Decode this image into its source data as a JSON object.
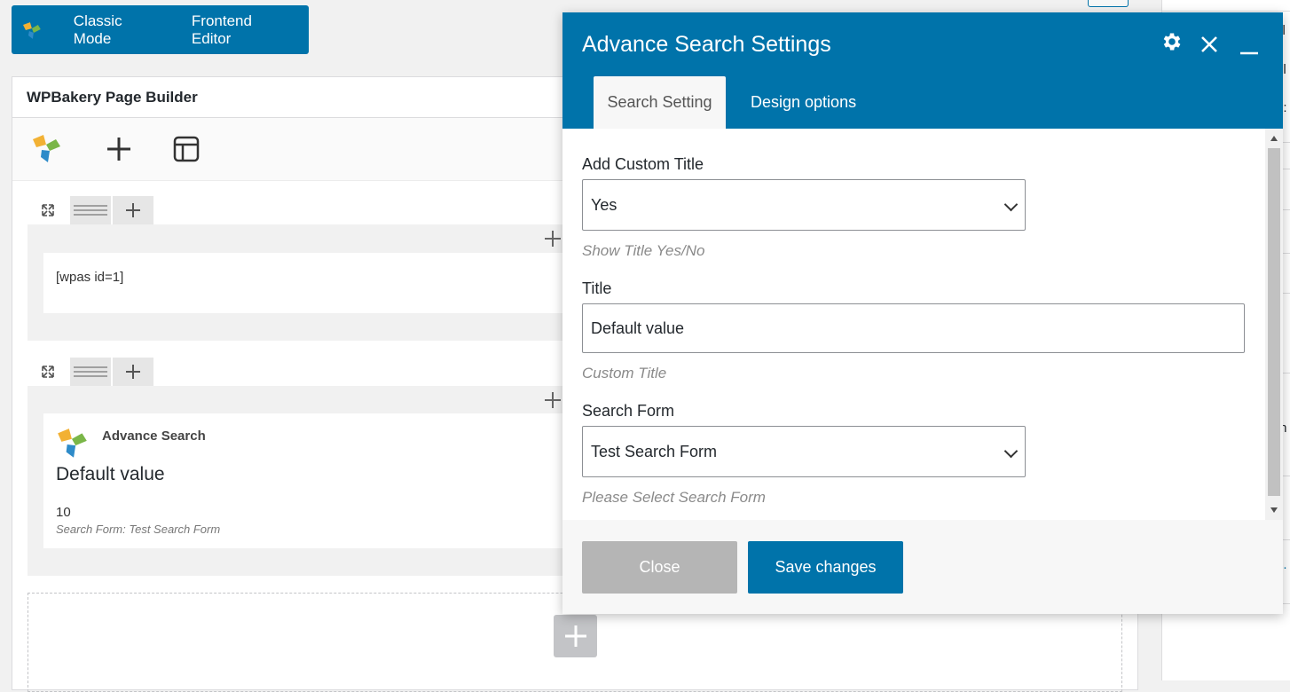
{
  "modebar": {
    "classic": "Classic Mode",
    "frontend": "Frontend Editor"
  },
  "builder": {
    "title": "WPBakery Page Builder",
    "row1": {
      "shortcode": "[wpas id=1]"
    },
    "row2": {
      "element_name": "Advance Search",
      "heading": "Default value",
      "count": "10",
      "form_line": "Search Form: Test Search Form"
    }
  },
  "modal": {
    "title": "Advance Search Settings",
    "tabs": [
      "Search Setting",
      "Design options"
    ],
    "fields": {
      "custom_title": {
        "label": "Add Custom Title",
        "value": "Yes",
        "hint": "Show Title Yes/No"
      },
      "title": {
        "label": "Title",
        "value": "Default value",
        "hint": "Custom Title"
      },
      "search_form": {
        "label": "Search Form",
        "value": "Test Search Form",
        "hint": "Please Select Search Form"
      }
    },
    "close_label": "Close",
    "save_label": "Save changes"
  },
  "sidebar": {
    "fragments": [
      "sl",
      "bl",
      "e:",
      "s",
      "th",
      "e",
      "g."
    ]
  },
  "colors": {
    "accent": "#0073aa",
    "close_gray": "#b5b5b5"
  }
}
